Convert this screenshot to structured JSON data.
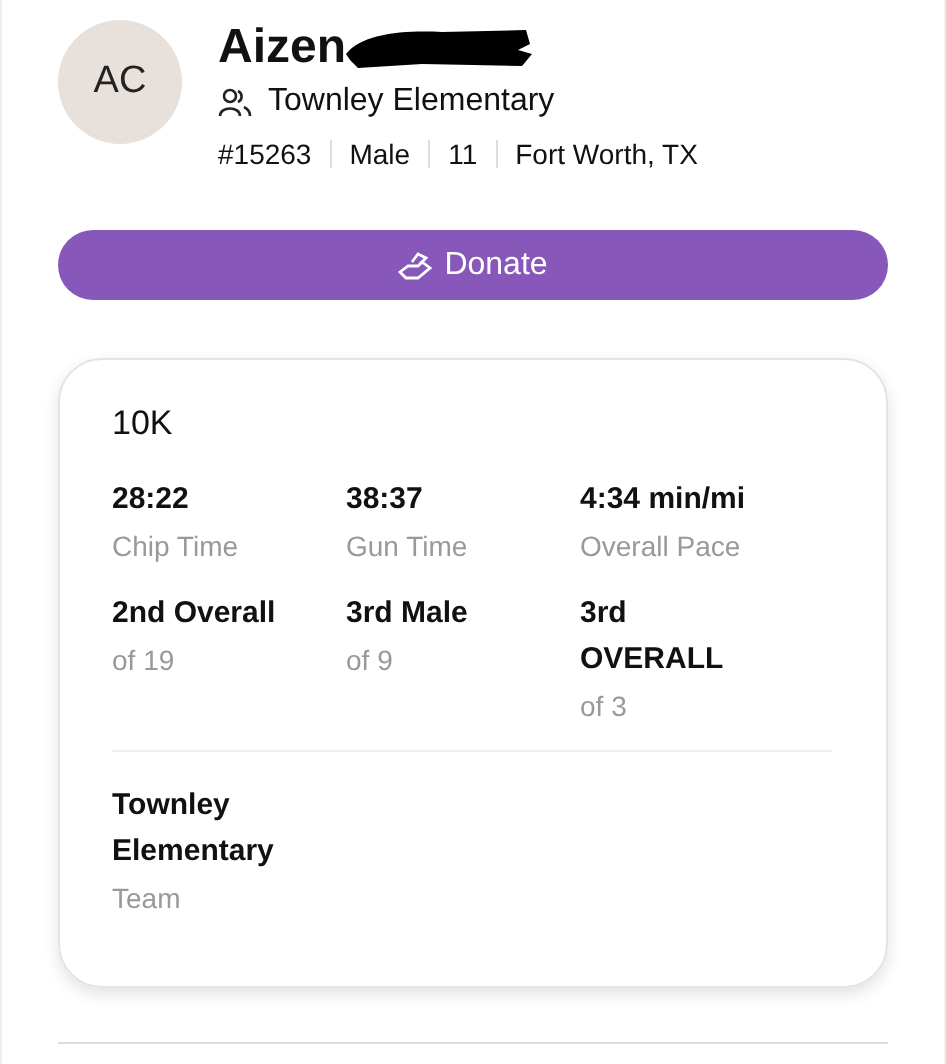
{
  "profile": {
    "initials": "AC",
    "name": "Aizen",
    "team": "Townley Elementary",
    "details": [
      "#15263",
      "Male",
      "11",
      "Fort Worth, TX"
    ]
  },
  "donate_button": {
    "label": "Donate"
  },
  "result": {
    "event": "10K",
    "stats": [
      {
        "value": "28:22",
        "label": "Chip Time"
      },
      {
        "value": "38:37",
        "label": "Gun Time"
      },
      {
        "value": "4:34 min/mi",
        "label": "Overall Pace"
      },
      {
        "value": "2nd Overall",
        "label": "of 19"
      },
      {
        "value": "3rd Male",
        "label": "of 9"
      },
      {
        "value": "3rd OVERALL",
        "label": "of 3"
      }
    ],
    "team": {
      "value": "Townley Elementary",
      "label": "Team"
    }
  }
}
